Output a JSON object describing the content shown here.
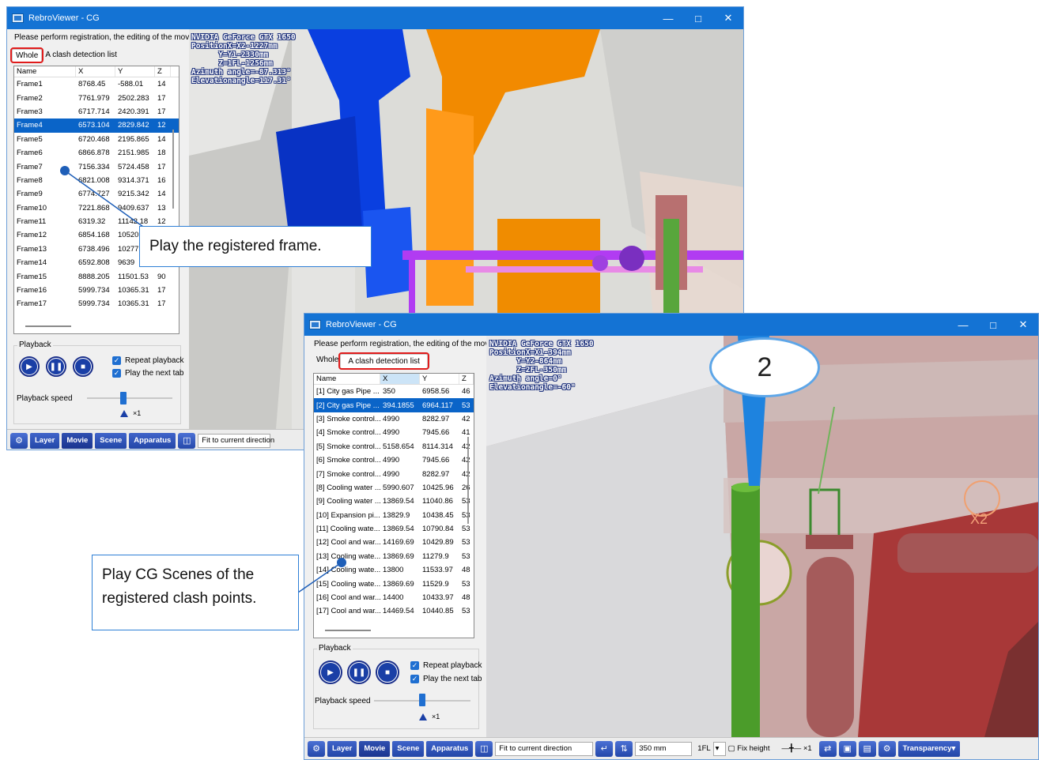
{
  "colors": {
    "titlebar": "#1473d4",
    "selection": "#0a64c8",
    "highlight": "#e01b1b",
    "accent": "#2e7fd6"
  },
  "window_back": {
    "title": "RebroViewer - CG",
    "notice": "Please perform registration, the editing of the movie in",
    "tabs": [
      "Whole",
      "A clash detection list"
    ],
    "columns": [
      "Name",
      "X",
      "Y",
      "Z"
    ],
    "rows": [
      [
        "Frame1",
        "8768.45",
        "-588.01",
        "14"
      ],
      [
        "Frame2",
        "7761.979",
        "2502.283",
        "17"
      ],
      [
        "Frame3",
        "6717.714",
        "2420.391",
        "17"
      ],
      [
        "Frame4",
        "6573.104",
        "2829.842",
        "12"
      ],
      [
        "Frame5",
        "6720.468",
        "2195.865",
        "14"
      ],
      [
        "Frame6",
        "6866.878",
        "2151.985",
        "18"
      ],
      [
        "Frame7",
        "7156.334",
        "5724.458",
        "17"
      ],
      [
        "Frame8",
        "6821.008",
        "9314.371",
        "16"
      ],
      [
        "Frame9",
        "6774.727",
        "9215.342",
        "14"
      ],
      [
        "Frame10",
        "7221.868",
        "9409.637",
        "13"
      ],
      [
        "Frame11",
        "6319.32",
        "11142.18",
        "12"
      ],
      [
        "Frame12",
        "6854.168",
        "10520",
        ""
      ],
      [
        "Frame13",
        "6738.496",
        "10277",
        ""
      ],
      [
        "Frame14",
        "6592.808",
        "9639",
        ""
      ],
      [
        "Frame15",
        "8888.205",
        "11501.53",
        "90"
      ],
      [
        "Frame16",
        "5999.734",
        "10365.31",
        "17"
      ],
      [
        "Frame17",
        "5999.734",
        "10365.31",
        "17"
      ]
    ],
    "playback_label": "Playback",
    "repeat_label": "Repeat playback",
    "next_tab_label": "Play the next tab",
    "speed_label": "Playback speed",
    "speed_mult": "×1",
    "osd": "NVIDIA GeForce GTX 1650\nPositionX=X2-1227mm\n      Y=Y1-2330mm\n      Z=1FL-1256mm\nAzimuth angle=-87.313°\nElevationangle=117.31°",
    "toolbar": {
      "layer": "Layer",
      "movie": "Movie",
      "scene": "Scene",
      "apparatus": "Apparatus",
      "direction": "Fit to current direction"
    }
  },
  "window_front": {
    "title": "RebroViewer - CG",
    "notice": "Please perform registration, the editing of the movie in",
    "tabs": [
      "Whole",
      "A clash detection list"
    ],
    "columns": [
      "Name",
      "X",
      "Y",
      "Z"
    ],
    "rows": [
      [
        "[1] City gas Pipe ...",
        "350",
        "6958.56",
        "46"
      ],
      [
        "[2] City gas Pipe ...",
        "394.1855",
        "6964.117",
        "53"
      ],
      [
        "[3] Smoke control...",
        "4990",
        "8282.97",
        "42"
      ],
      [
        "[4] Smoke control...",
        "4990",
        "7945.66",
        "41"
      ],
      [
        "[5] Smoke control...",
        "5158.654",
        "8114.314",
        "42"
      ],
      [
        "[6] Smoke control...",
        "4990",
        "7945.66",
        "42"
      ],
      [
        "[7] Smoke control...",
        "4990",
        "8282.97",
        "42"
      ],
      [
        "[8] Cooling water ...",
        "5990.607",
        "10425.96",
        "26"
      ],
      [
        "[9] Cooling water ...",
        "13869.54",
        "11040.86",
        "53"
      ],
      [
        "[10] Expansion pi...",
        "13829.9",
        "10438.45",
        "53"
      ],
      [
        "[11] Cooling wate...",
        "13869.54",
        "10790.84",
        "53"
      ],
      [
        "[12] Cool and war...",
        "14169.69",
        "10429.89",
        "53"
      ],
      [
        "[13] Cooling wate...",
        "13869.69",
        "11279.9",
        "53"
      ],
      [
        "[14] Cooling wate...",
        "13800",
        "11533.97",
        "48"
      ],
      [
        "[15] Cooling wate...",
        "13869.69",
        "11529.9",
        "53"
      ],
      [
        "[16] Cool and war...",
        "14400",
        "10433.97",
        "48"
      ],
      [
        "[17] Cool and war...",
        "14469.54",
        "10440.85",
        "53"
      ]
    ],
    "playback_label": "Playback",
    "repeat_label": "Repeat playback",
    "next_tab_label": "Play the next tab",
    "speed_label": "Playback speed",
    "speed_mult": "×1",
    "osd": "NVIDIA GeForce GTX 1650\nPositionX=X1-394mm\n      Y=Y2-864mm\n      Z=2FL-350mm\nAzimuth angle=0°\nElevationangle=-60°",
    "badge_number": "2",
    "grid_label": "X2",
    "toolbar": {
      "layer": "Layer",
      "movie": "Movie",
      "scene": "Scene",
      "apparatus": "Apparatus",
      "direction": "Fit to current direction",
      "height": "350 mm",
      "floor": "1FL",
      "fix_height": "Fix height",
      "transparency": "Transparency",
      "speed": "×1"
    }
  },
  "callouts": {
    "frame": "Play the registered frame.",
    "clash": "Play CG Scenes of the registered clash points."
  }
}
